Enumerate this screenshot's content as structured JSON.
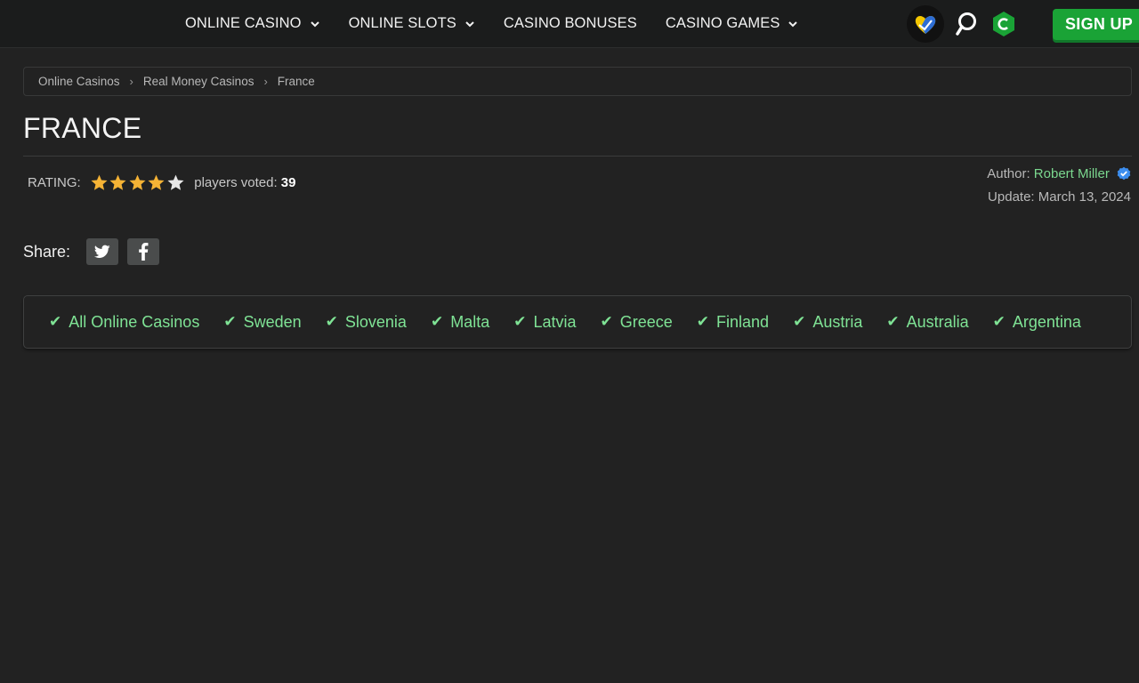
{
  "nav": {
    "items": [
      {
        "label": "ONLINE CASINO",
        "dropdown": true
      },
      {
        "label": "ONLINE SLOTS",
        "dropdown": true
      },
      {
        "label": "CASINO BONUSES",
        "dropdown": false
      },
      {
        "label": "CASINO GAMES",
        "dropdown": true
      }
    ],
    "signup_label": "SIGN UP"
  },
  "breadcrumb": {
    "items": [
      "Online Casinos",
      "Real Money Casinos",
      "France"
    ]
  },
  "page": {
    "title": "FRANCE"
  },
  "rating": {
    "label": "RATING:",
    "stars_filled": 4,
    "stars_total": 5,
    "votes_label": "players voted:",
    "votes_count": "39"
  },
  "meta": {
    "author_label": "Author:",
    "author_name": "Robert Miller",
    "update_label": "Update:",
    "update_date": "March 13, 2024"
  },
  "share": {
    "label": "Share:",
    "buttons": [
      "twitter-icon",
      "facebook-icon"
    ]
  },
  "countries": {
    "check_glyph": "✔",
    "items": [
      "All Online Casinos",
      "Sweden",
      "Slovenia",
      "Malta",
      "Latvia",
      "Greece",
      "Finland",
      "Austria",
      "Australia",
      "Argentina"
    ]
  },
  "colors": {
    "background": "#222222",
    "accent_green": "#7fe395",
    "signup_green": "#1aa336",
    "star_gold": "#f5b335"
  }
}
